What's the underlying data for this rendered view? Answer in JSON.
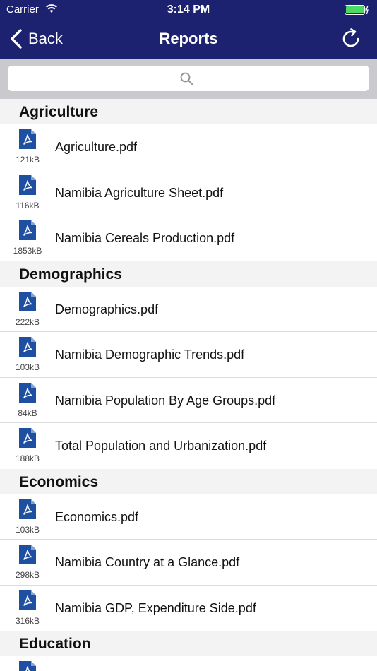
{
  "status": {
    "carrier": "Carrier",
    "time": "3:14 PM"
  },
  "nav": {
    "back_label": "Back",
    "title": "Reports"
  },
  "search": {
    "placeholder": ""
  },
  "sections": [
    {
      "title": "Agriculture",
      "items": [
        {
          "name": "Agriculture.pdf",
          "size": "121kB"
        },
        {
          "name": "Namibia Agriculture Sheet.pdf",
          "size": "116kB"
        },
        {
          "name": "Namibia Cereals Production.pdf",
          "size": "1853kB"
        }
      ]
    },
    {
      "title": "Demographics",
      "items": [
        {
          "name": "Demographics.pdf",
          "size": "222kB"
        },
        {
          "name": "Namibia Demographic Trends.pdf",
          "size": "103kB"
        },
        {
          "name": "Namibia Population By Age Groups.pdf",
          "size": "84kB"
        },
        {
          "name": "Total Population and Urbanization.pdf",
          "size": "188kB"
        }
      ]
    },
    {
      "title": "Economics",
      "items": [
        {
          "name": "Economics.pdf",
          "size": "103kB"
        },
        {
          "name": "Namibia Country at a Glance.pdf",
          "size": "298kB"
        },
        {
          "name": "Namibia GDP, Expenditure Side.pdf",
          "size": "316kB"
        }
      ]
    },
    {
      "title": "Education",
      "items": [
        {
          "name": "",
          "size": ""
        }
      ]
    }
  ],
  "icons": {
    "file": "pdf-file-icon",
    "back": "chevron-left-icon",
    "refresh": "refresh-icon",
    "search": "search-icon"
  },
  "colors": {
    "navbar": "#1c2170",
    "pdf_icon": "#1f4fa0",
    "section_bg": "#f3f3f3",
    "battery": "#4cd964"
  }
}
